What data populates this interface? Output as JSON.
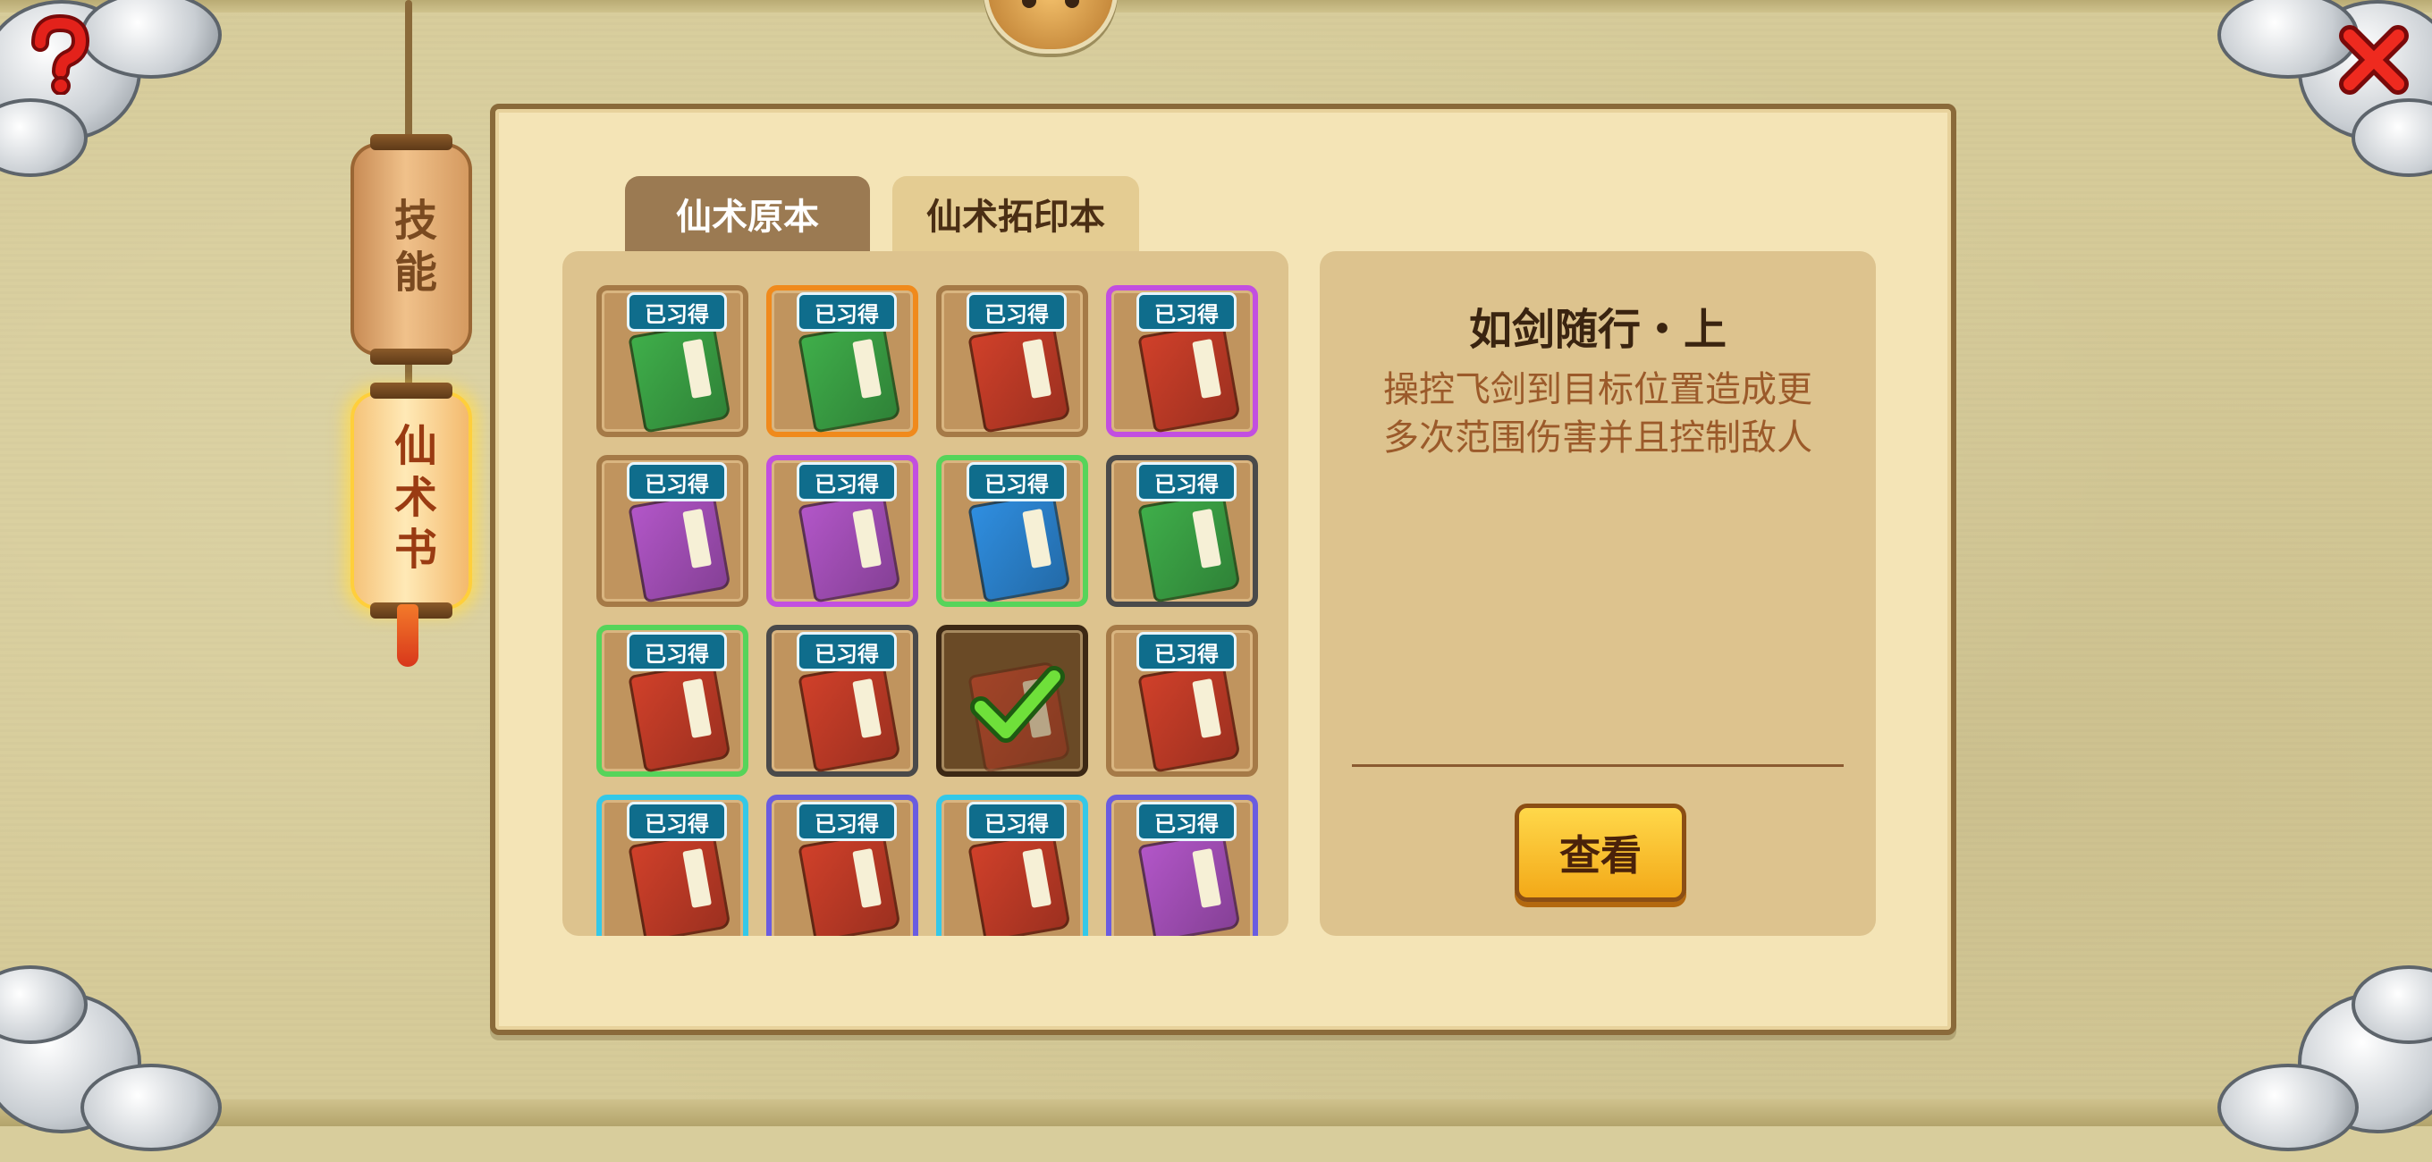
{
  "hud": {
    "help_icon": "question-mark-icon",
    "close_icon": "red-x-icon"
  },
  "side_tabs": [
    {
      "label": "技能",
      "state": "inactive"
    },
    {
      "label": "仙术书",
      "state": "active"
    }
  ],
  "tabs": [
    {
      "label": "仙术原本",
      "state": "inactive"
    },
    {
      "label": "仙术拓印本",
      "state": "active"
    }
  ],
  "grid": {
    "badge_text": "已习得",
    "items": [
      {
        "book_color": "green",
        "frame": "plain",
        "learned": true
      },
      {
        "book_color": "green",
        "frame": "orange",
        "learned": true
      },
      {
        "book_color": "red",
        "frame": "plain",
        "learned": true
      },
      {
        "book_color": "red",
        "frame": "purple",
        "learned": true
      },
      {
        "book_color": "purple",
        "frame": "plain",
        "learned": true
      },
      {
        "book_color": "purple",
        "frame": "purple",
        "learned": true
      },
      {
        "book_color": "blue",
        "frame": "green",
        "learned": true
      },
      {
        "book_color": "green",
        "frame": "dark",
        "learned": true
      },
      {
        "book_color": "red",
        "frame": "green",
        "learned": true
      },
      {
        "book_color": "red",
        "frame": "dark",
        "learned": true
      },
      {
        "book_color": "red",
        "frame": "selected",
        "learned": false,
        "selected": true
      },
      {
        "book_color": "red",
        "frame": "plain",
        "learned": true
      },
      {
        "book_color": "red",
        "frame": "cyan",
        "learned": true
      },
      {
        "book_color": "red",
        "frame": "indigo",
        "learned": true
      },
      {
        "book_color": "red",
        "frame": "cyan",
        "learned": true
      },
      {
        "book_color": "purple",
        "frame": "indigo",
        "learned": true
      }
    ]
  },
  "detail": {
    "title": "如剑随行・上",
    "description_lines": [
      "操控飞剑到目标位置造成更",
      "多次范围伤害并且控制敌人"
    ],
    "view_button": "查看"
  },
  "colors": {
    "book_green": "#3fae4a",
    "book_red": "#d0402a",
    "book_purple": "#b256c8",
    "book_blue": "#2f8ee0",
    "frame_orange": "#f08a1c",
    "frame_purple": "#c24fe0",
    "frame_green": "#56d45a",
    "frame_dark": "#4a4a4a",
    "frame_cyan": "#34c8e8",
    "frame_indigo": "#6a5ce0",
    "frame_plain": "#a57a47"
  }
}
